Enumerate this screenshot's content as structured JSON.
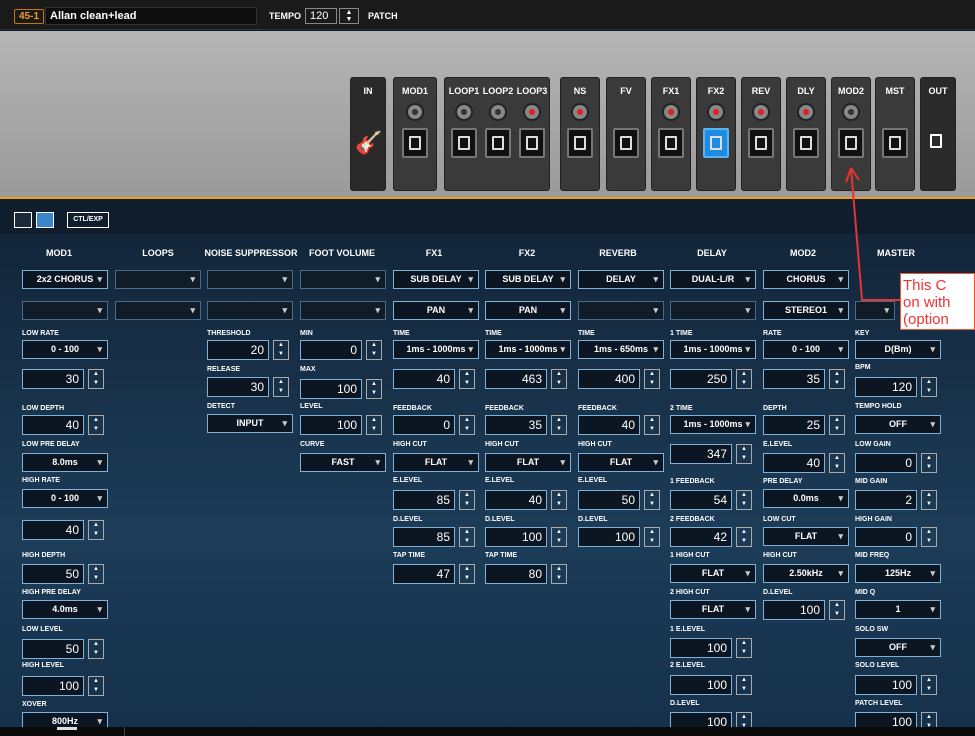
{
  "patch": {
    "number": "45-1",
    "name": "Allan clean+lead",
    "tempo_label": "TEMPO",
    "tempo": "120",
    "patch_label": "PATCH"
  },
  "chain": {
    "blocks": [
      {
        "label": "IN"
      },
      {
        "label": "MOD1"
      },
      {
        "label": "LOOP1"
      },
      {
        "label": "LOOP2"
      },
      {
        "label": "LOOP3"
      },
      {
        "label": "NS"
      },
      {
        "label": "FV"
      },
      {
        "label": "FX1"
      },
      {
        "label": "FX2"
      },
      {
        "label": "REV"
      },
      {
        "label": "DLY"
      },
      {
        "label": "MOD2"
      },
      {
        "label": "MST"
      },
      {
        "label": "OUT"
      }
    ]
  },
  "toolbar": {
    "ctl_exp": "CTL/EXP"
  },
  "columns": [
    "MOD1",
    "LOOPS",
    "NOISE SUPPRESSOR",
    "FOOT VOLUME",
    "FX1",
    "FX2",
    "REVERB",
    "DELAY",
    "MOD2",
    "MASTER"
  ],
  "selects": {
    "mod1_type": "2x2 CHORUS",
    "fx1_type": "SUB DELAY",
    "fx2_type": "SUB DELAY",
    "rev_type": "DELAY",
    "dly_type": "DUAL-L/R",
    "mod2_type": "CHORUS",
    "fx1_sub": "PAN",
    "fx2_sub": "PAN",
    "mod2_sub": "STEREO1"
  },
  "mod1": {
    "low_rate_l": "LOW RATE",
    "low_rate": "0 - 100",
    "low_rate_v": "30",
    "low_depth_l": "LOW DEPTH",
    "low_depth": "40",
    "low_pre_l": "LOW PRE DELAY",
    "low_pre": "8.0ms",
    "high_rate_l": "HIGH RATE",
    "high_rate": "0 - 100",
    "high_rate_v": "40",
    "high_depth_l": "HIGH DEPTH",
    "high_depth": "50",
    "high_pre_l": "HIGH PRE DELAY",
    "high_pre": "4.0ms",
    "low_level_l": "LOW LEVEL",
    "low_level": "50",
    "high_level_l": "HIGH LEVEL",
    "high_level": "100",
    "xover_l": "XOVER",
    "xover": "800Hz"
  },
  "ns": {
    "threshold_l": "THRESHOLD",
    "threshold": "20",
    "release_l": "RELEASE",
    "release": "30",
    "detect_l": "DETECT",
    "detect": "INPUT"
  },
  "fv": {
    "min_l": "MIN",
    "min": "0",
    "max_l": "MAX",
    "max": "100",
    "level_l": "LEVEL",
    "level": "100",
    "curve_l": "CURVE",
    "curve": "FAST"
  },
  "fx1": {
    "time_l": "TIME",
    "time_range": "1ms - 1000ms",
    "time": "40",
    "fb_l": "FEEDBACK",
    "fb": "0",
    "hc_l": "HIGH CUT",
    "hc": "FLAT",
    "el_l": "E.LEVEL",
    "el": "85",
    "dl_l": "D.LEVEL",
    "dl": "85",
    "tap_l": "TAP TIME",
    "tap": "47"
  },
  "fx2": {
    "time_l": "TIME",
    "time_range": "1ms - 1000ms",
    "time": "463",
    "fb_l": "FEEDBACK",
    "fb": "35",
    "hc_l": "HIGH CUT",
    "hc": "FLAT",
    "el_l": "E.LEVEL",
    "el": "40",
    "dl_l": "D.LEVEL",
    "dl": "100",
    "tap_l": "TAP TIME",
    "tap": "80"
  },
  "rev": {
    "time_l": "TIME",
    "time_range": "1ms - 650ms",
    "time": "400",
    "fb_l": "FEEDBACK",
    "fb": "40",
    "hc_l": "HIGH CUT",
    "hc": "FLAT",
    "el_l": "E.LEVEL",
    "el": "50",
    "dl_l": "D.LEVEL",
    "dl": "100"
  },
  "dly": {
    "t1_l": "1 TIME",
    "t1_range": "1ms - 1000ms",
    "t1": "250",
    "t2_l": "2 TIME",
    "t2_range": "1ms - 1000ms",
    "t2": "347",
    "fb1_l": "1 FEEDBACK",
    "fb1": "54",
    "fb2_l": "2 FEEDBACK",
    "fb2": "42",
    "hc1_l": "1 HIGH CUT",
    "hc1": "FLAT",
    "hc2_l": "2 HIGH CUT",
    "hc2": "FLAT",
    "el1_l": "1 E.LEVEL",
    "el1": "100",
    "el2_l": "2 E.LEVEL",
    "el2": "100",
    "dl_l": "D.LEVEL",
    "dl": "100"
  },
  "mod2": {
    "rate_l": "RATE",
    "rate": "0 - 100",
    "rate_v": "35",
    "depth_l": "DEPTH",
    "depth": "25",
    "el_l": "E.LEVEL",
    "el": "40",
    "pre_l": "PRE DELAY",
    "pre": "0.0ms",
    "lc_l": "LOW CUT",
    "lc": "FLAT",
    "hc_l": "HIGH CUT",
    "hc": "2.50kHz",
    "dl_l": "D.LEVEL",
    "dl": "100"
  },
  "master": {
    "key_l": "KEY",
    "key": "D(Bm)",
    "bpm_l": "BPM",
    "bpm": "120",
    "th_l": "TEMPO HOLD",
    "th": "OFF",
    "lg_l": "LOW GAIN",
    "lg": "0",
    "mg_l": "MID GAIN",
    "mg": "2",
    "hg_l": "HIGH GAIN",
    "hg": "0",
    "mf_l": "MID FREQ",
    "mf": "125Hz",
    "mq_l": "MID Q",
    "mq": "1",
    "ss_l": "SOLO SW",
    "ss": "OFF",
    "sl_l": "SOLO LEVEL",
    "sl": "100",
    "pl_l": "PATCH LEVEL",
    "pl": "100"
  },
  "callout": {
    "line1": "This C",
    "line2": "on with",
    "line3": "(option"
  },
  "colors": {
    "accent": "#f0a020",
    "selected": "#1e8ce0",
    "border": "#7eb0d8",
    "callout": "#e53333"
  }
}
